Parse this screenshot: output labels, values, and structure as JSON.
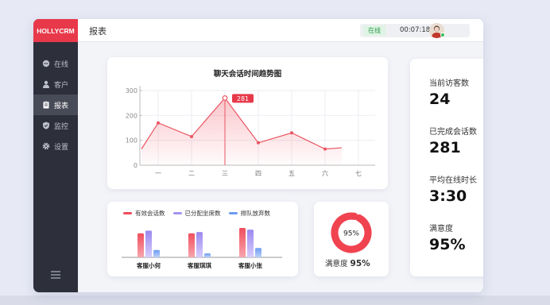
{
  "app": {
    "brand": "HOLLYCRM",
    "page_title": "报表"
  },
  "sidebar": {
    "items": [
      {
        "label": "在线",
        "icon": "chat-icon"
      },
      {
        "label": "客户",
        "icon": "user-icon"
      },
      {
        "label": "报表",
        "icon": "report-icon",
        "active": true
      },
      {
        "label": "监控",
        "icon": "shield-icon"
      },
      {
        "label": "设置",
        "icon": "gear-icon"
      }
    ],
    "menu_icon": "menu-icon"
  },
  "header": {
    "status": "在线",
    "timer": "00:07:18",
    "status_color": "#2e9b4a"
  },
  "line_chart": {
    "title": "聊天会话时间趋势图",
    "tooltip": "281"
  },
  "bar_chart": {
    "legend": [
      "有效会话数",
      "已分配坐席数",
      "排队放弃数"
    ]
  },
  "donut": {
    "percent_text": "95%",
    "label": "满意度",
    "value": "95%"
  },
  "stats": [
    {
      "label": "当前访客数",
      "value": "24"
    },
    {
      "label": "已完成会话数",
      "value": "281"
    },
    {
      "label": "平均在线时长",
      "value": "3:30"
    },
    {
      "label": "满意度",
      "value": "95%"
    }
  ],
  "colors": {
    "accent": "#e7394a",
    "series_purple": "#a593f2",
    "series_blue": "#6d9cf2"
  },
  "chart_data": [
    {
      "type": "line",
      "title": "聊天会话时间趋势图",
      "categories": [
        "一",
        "二",
        "三",
        "四",
        "五",
        "六",
        "七"
      ],
      "x": [
        0.5,
        1,
        2,
        3,
        4,
        5,
        6,
        6.5
      ],
      "values": [
        65,
        170,
        115,
        270,
        90,
        130,
        65,
        70
      ],
      "ylim": [
        0,
        300
      ],
      "yticks": [
        "0",
        "100",
        "200",
        "300"
      ],
      "annotation": "281",
      "grid": true
    },
    {
      "type": "bar",
      "categories": [
        "客服小何",
        "客服琪琪",
        "客服小张"
      ],
      "series": [
        {
          "name": "有效会话数",
          "values": [
            0.72,
            0.72,
            0.88
          ]
        },
        {
          "name": "已分配坐席数",
          "values": [
            0.8,
            0.76,
            0.83
          ]
        },
        {
          "name": "排队放弃数",
          "values": [
            0.22,
            0.12,
            0.28
          ]
        }
      ]
    },
    {
      "type": "pie",
      "values": [
        95,
        5
      ],
      "labels": [
        "95%",
        ""
      ]
    }
  ]
}
